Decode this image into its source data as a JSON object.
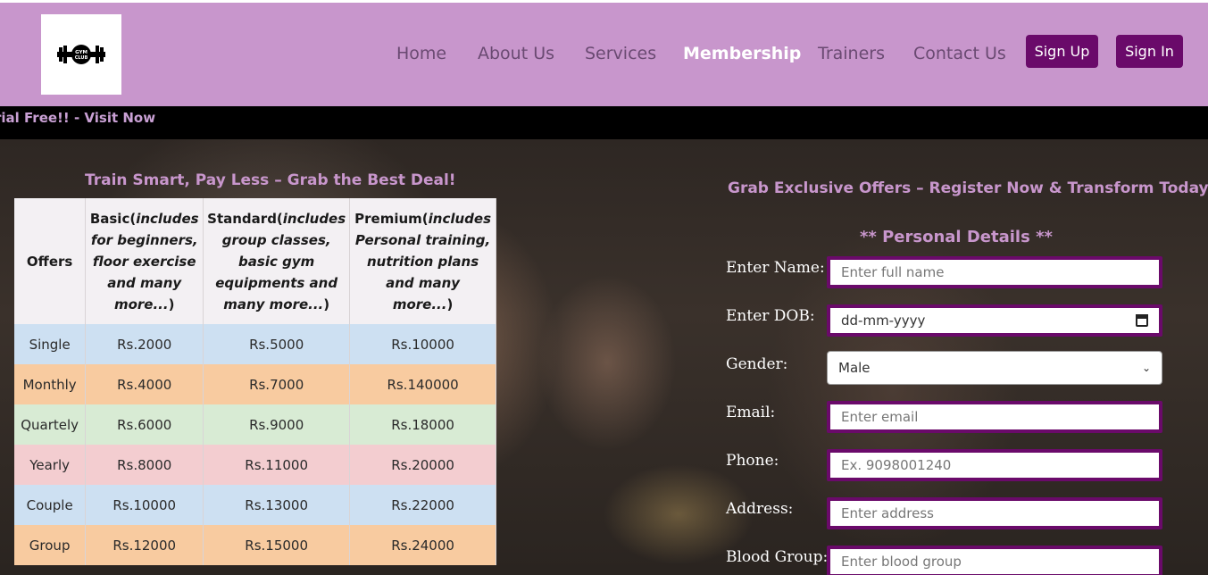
{
  "nav": {
    "logo_text": "GYM CLUB",
    "links": [
      "Home",
      "About Us",
      "Services",
      "Membership",
      "Trainers",
      "Contact Us"
    ],
    "active": "Membership",
    "signup": "Sign Up",
    "signin": "Sign In"
  },
  "marquee": "rial Free!! - Visit Now",
  "pricing": {
    "title": "Train Smart, Pay Less – Grab the Best Deal!",
    "headers": [
      {
        "main": "Offers",
        "sub": ""
      },
      {
        "main": "Basic(",
        "sub": "includes for beginners, floor exercise and many more...",
        "close": ")"
      },
      {
        "main": "Standard(",
        "sub": "includes group classes, basic gym equipments and many more...",
        "close": ")"
      },
      {
        "main": "Premium(",
        "sub": "includes Personal training, nutrition plans and many more...",
        "close": ")"
      }
    ],
    "rows": [
      {
        "offer": "Single",
        "basic": "Rs.2000",
        "standard": "Rs.5000",
        "premium": "Rs.10000"
      },
      {
        "offer": "Monthly",
        "basic": "Rs.4000",
        "standard": "Rs.7000",
        "premium": "Rs.140000"
      },
      {
        "offer": "Quartely",
        "basic": "Rs.6000",
        "standard": "Rs.9000",
        "premium": "Rs.18000"
      },
      {
        "offer": "Yearly",
        "basic": "Rs.8000",
        "standard": "Rs.11000",
        "premium": "Rs.20000"
      },
      {
        "offer": "Couple",
        "basic": "Rs.10000",
        "standard": "Rs.13000",
        "premium": "Rs.22000"
      },
      {
        "offer": "Group",
        "basic": "Rs.12000",
        "standard": "Rs.15000",
        "premium": "Rs.24000"
      }
    ],
    "row_colors": [
      "#cde0f2",
      "#f8cba0",
      "#d8ebd4",
      "#f3cdd0",
      "#cde0f2",
      "#f8cba0"
    ]
  },
  "form": {
    "title": "Grab Exclusive Offers – Register Now & Transform Today!",
    "section": "** Personal Details **",
    "fields": {
      "name": {
        "label": "Enter Name:",
        "placeholder": "Enter full name"
      },
      "dob": {
        "label": "Enter DOB:",
        "placeholder": "dd-mm-yyyy"
      },
      "gender": {
        "label": "Gender:",
        "value": "Male"
      },
      "email": {
        "label": "Email:",
        "placeholder": "Enter email"
      },
      "phone": {
        "label": "Phone:",
        "placeholder": "Ex. 9098001240"
      },
      "address": {
        "label": "Address:",
        "placeholder": "Enter address"
      },
      "blood": {
        "label": "Blood Group:",
        "placeholder": "Enter blood group"
      }
    }
  },
  "colors": {
    "nav_bg": "#c896cc",
    "button_bg": "#6a0a6a",
    "accent_text": "#c896cc"
  },
  "icons": [
    "gym-logo-icon",
    "calendar-icon",
    "chevron-down-icon"
  ]
}
